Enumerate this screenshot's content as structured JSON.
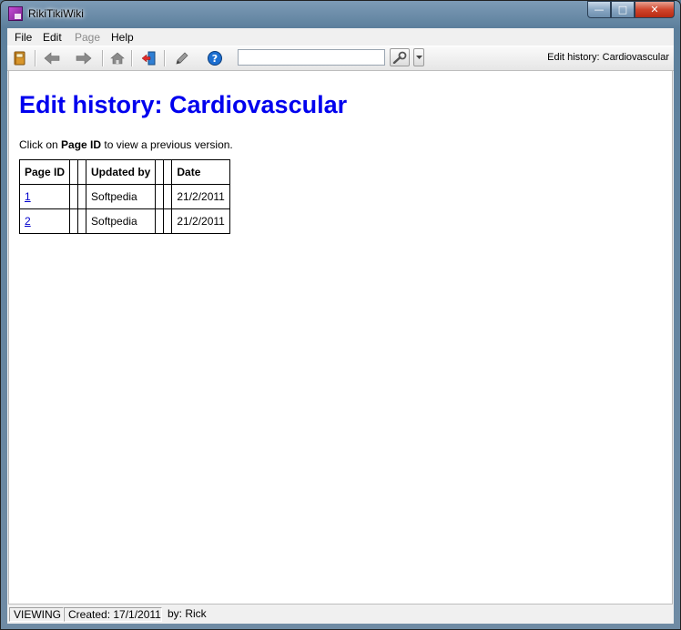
{
  "window": {
    "title": "RikiTikiWiki",
    "buttons": {
      "minimize": "—",
      "maximize": "□",
      "close": "✕"
    }
  },
  "menu": {
    "items": [
      {
        "label": "File",
        "enabled": true
      },
      {
        "label": "Edit",
        "enabled": true
      },
      {
        "label": "Page",
        "enabled": false
      },
      {
        "label": "Help",
        "enabled": true
      }
    ]
  },
  "toolbar": {
    "icons": [
      "notebook-icon",
      "back-arrow-icon",
      "forward-arrow-icon",
      "home-icon",
      "import-icon",
      "edit-pencil-icon",
      "help-icon",
      "search-icon",
      "dropdown-arrow-icon"
    ],
    "search": {
      "value": "",
      "placeholder": ""
    },
    "current_page_label": "Edit history: Cardiovascular"
  },
  "page": {
    "title": "Edit history: Cardiovascular",
    "instruction": {
      "prefix": "Click on ",
      "bold": "Page ID",
      "suffix": " to view a previous version."
    },
    "table": {
      "headers": [
        "Page ID",
        "",
        "",
        "Updated by",
        "",
        "",
        "Date"
      ],
      "rows": [
        {
          "page_id": "1",
          "updated_by": "Softpedia",
          "date": "21/2/2011"
        },
        {
          "page_id": "2",
          "updated_by": "Softpedia",
          "date": "21/2/2011"
        }
      ]
    }
  },
  "status": {
    "mode": "VIEWING",
    "created": "Created: 17/1/2011",
    "by": "by: Rick"
  },
  "colors": {
    "link": "#0000ee",
    "title_blue": "#0000ee"
  }
}
